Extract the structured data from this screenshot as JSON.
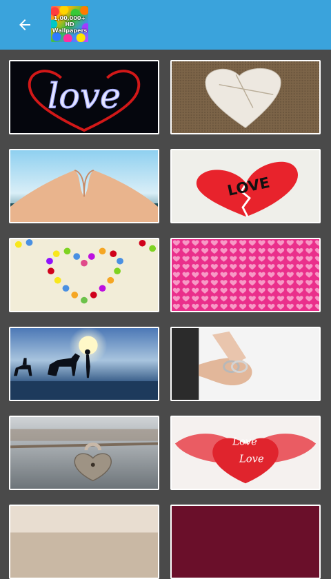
{
  "appbar": {
    "back_icon": "arrow-left-icon",
    "logo_lines": [
      "1,00,000+",
      "HD",
      "Wallpapers"
    ],
    "background": "#3aa3dc"
  },
  "tiles": [
    {
      "subject": "neon-love-script"
    },
    {
      "subject": "paper-heart-on-burlap"
    },
    {
      "subject": "hands-heart-shape"
    },
    {
      "subject": "red-broken-heart-love"
    },
    {
      "subject": "candy-heart"
    },
    {
      "subject": "pink-hearts-pattern"
    },
    {
      "subject": "horse-silhouette-sunset"
    },
    {
      "subject": "hand-with-rings"
    },
    {
      "subject": "heart-padlock"
    },
    {
      "subject": "red-hearts-love-text"
    },
    {
      "subject": "partial-tile"
    },
    {
      "subject": "partial-tile"
    }
  ],
  "tile_text": {
    "love_neon": "love",
    "love_red": "LOVE",
    "love_script_1": "Love",
    "love_script_2": "Love"
  }
}
